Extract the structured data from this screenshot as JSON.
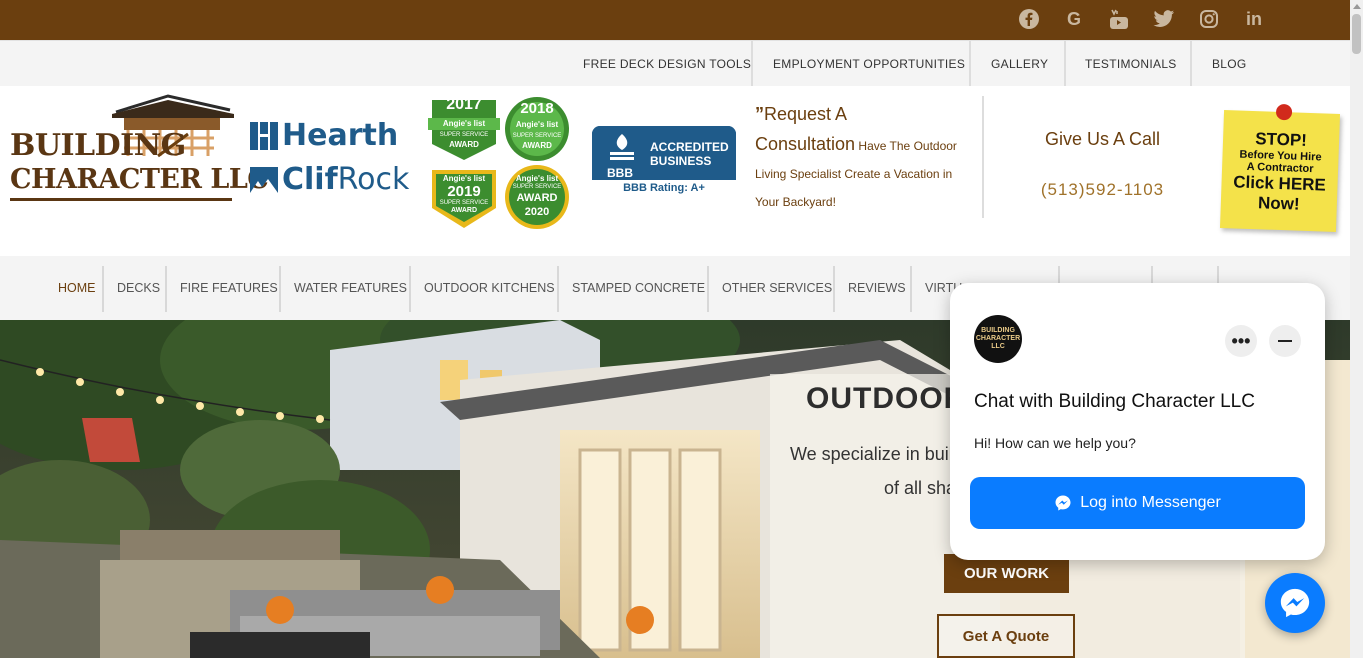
{
  "topbar": {
    "social": [
      "facebook-icon",
      "google-icon",
      "youtube-icon",
      "twitter-icon",
      "instagram-icon",
      "linkedin-icon"
    ],
    "google_glyph": "G",
    "youtube_glyph": "You",
    "linkedin_glyph": "in"
  },
  "subnav": {
    "items": [
      "FREE DECK DESIGN TOOLS",
      "EMPLOYMENT OPPORTUNITIES",
      "GALLERY",
      "TESTIMONIALS",
      "BLOG"
    ]
  },
  "header": {
    "logo": {
      "line1": "BUILDING",
      "line2": "CHARACTER LLC"
    },
    "hearth": "Hearth",
    "clif": {
      "a": "Clif",
      "b": "Rock"
    },
    "badges": [
      {
        "year": "2017",
        "brand": "Angie's list",
        "l1": "SUPER SERVICE",
        "l2": "AWARD"
      },
      {
        "year": "2018",
        "brand": "Angie's list",
        "l1": "SUPER SERVICE",
        "l2": "AWARD"
      },
      {
        "year": "2019",
        "brand": "Angie's list",
        "l1": "SUPER SERVICE",
        "l2": "AWARD"
      },
      {
        "year": "2020",
        "brand": "Angie's list",
        "l1": "SUPER SERVICE",
        "l2": "AWARD"
      }
    ],
    "bbb": {
      "logo": "BBB",
      "line1": "ACCREDITED",
      "line2": "BUSINESS",
      "rating": "BBB Rating: A+"
    },
    "request": {
      "quote_mark": "”",
      "big1": "Request A",
      "big2": "Consultation",
      "small": "Have The Outdoor Living Specialist Create a Vacation in Your Backyard!"
    },
    "call": {
      "title": "Give Us A Call",
      "phone": "(513)592-1103"
    },
    "stop": {
      "l1": "STOP!",
      "l2": "Before You Hire",
      "l3": "A Contractor",
      "l4": "Click HERE",
      "l5": "Now!"
    }
  },
  "mainnav": {
    "items": [
      "HOME",
      "DECKS",
      "FIRE FEATURES",
      "WATER FEATURES",
      "OUTDOOR KITCHENS",
      "STAMPED CONCRETE",
      "OTHER SERVICES",
      "REVIEWS",
      "VIRTU"
    ]
  },
  "hero": {
    "title": "OUTDOOR",
    "line1": "We specialize in buil",
    "line2": "of all sha",
    "btn_work": "OUR WORK",
    "btn_quote": "Get A Quote"
  },
  "chat": {
    "avatar": "BUILDING CHARACTER LLC",
    "more": "•••",
    "title": "Chat with Building Character LLC",
    "subtitle": "Hi! How can we help you?",
    "button": "Log into Messenger"
  },
  "colors": {
    "brand_brown": "#6b3f0f",
    "messenger_blue": "#0a7cff"
  }
}
